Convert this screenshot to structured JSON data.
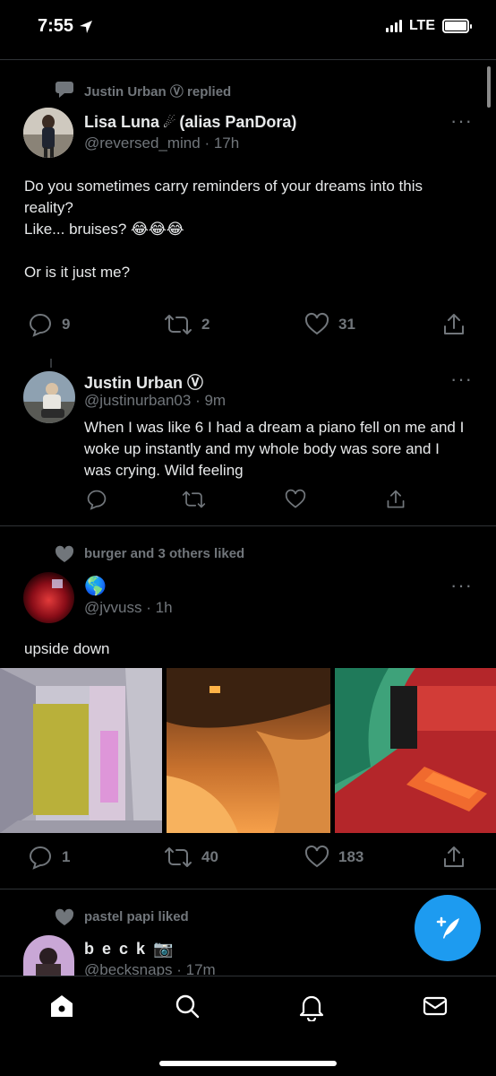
{
  "status_bar": {
    "time": "7:55",
    "network": "LTE"
  },
  "tweets": [
    {
      "context": "Justin Urban Ⓥ replied",
      "name": "Lisa Luna",
      "name_emoji": "☄",
      "name_suffix": "(alias PanDora)",
      "handle": "@reversed_mind",
      "time": "· 17h",
      "body": [
        "Do you sometimes carry reminders of your dreams into this reality?",
        "",
        "Like... bruises? 😂😂😂",
        "",
        "Or is it just me?"
      ],
      "replies": "9",
      "retweets": "2",
      "likes": "31"
    },
    {
      "name": "Justin Urban Ⓥ",
      "handle": "@justinurban03",
      "time": "· 9m",
      "body": "When I was like 6 I had a dream a piano fell on me and I woke up instantly and my whole body was sore and I was crying. Wild feeling"
    },
    {
      "context": "burger and 3 others liked",
      "name": "🌎",
      "handle": "@jvvuss",
      "time": "· 1h",
      "body": "upside down",
      "replies": "1",
      "retweets": "40",
      "likes": "183"
    },
    {
      "context": "pastel papi liked",
      "name": "b e c k 📷",
      "handle": "@becksnaps",
      "time": "· 17m"
    }
  ],
  "colors": {
    "accent": "#1d9bf0",
    "muted": "#71767b",
    "background": "#000000"
  },
  "icons": {
    "tab_home": "home-icon",
    "tab_search": "search-icon",
    "tab_notifications": "bell-icon",
    "tab_messages": "mail-icon",
    "compose": "compose-tweet-icon"
  }
}
